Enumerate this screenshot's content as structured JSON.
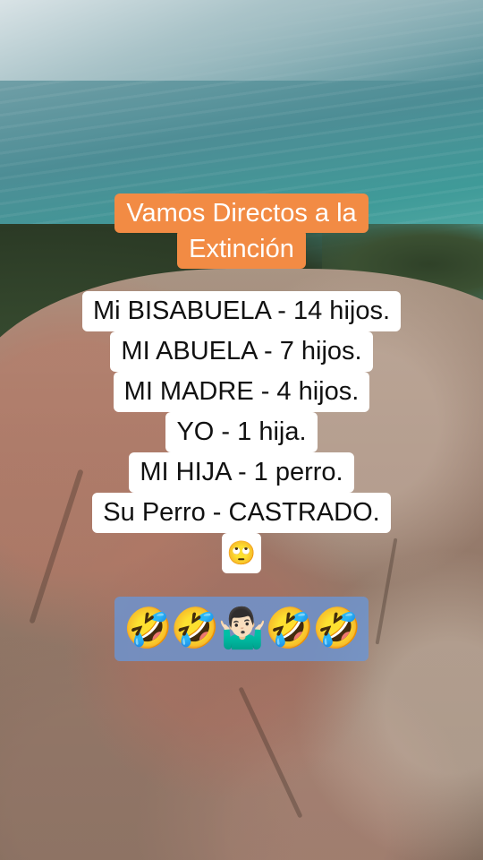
{
  "title": {
    "line1": "Vamos Directos a la",
    "line2": "Extinción",
    "color": "#f28b44"
  },
  "lines": [
    "Mi BISABUELA - 14 hijos.",
    "MI ABUELA - 7 hijos.",
    "MI MADRE - 4 hijos.",
    "YO - 1 hija.",
    "MI HIJA - 1 perro.",
    "Su Perro - CASTRADO."
  ],
  "eye_roll_emoji": "🙄",
  "reaction_emojis": "🤣🤣🤷🏻‍♂️🤣🤣"
}
